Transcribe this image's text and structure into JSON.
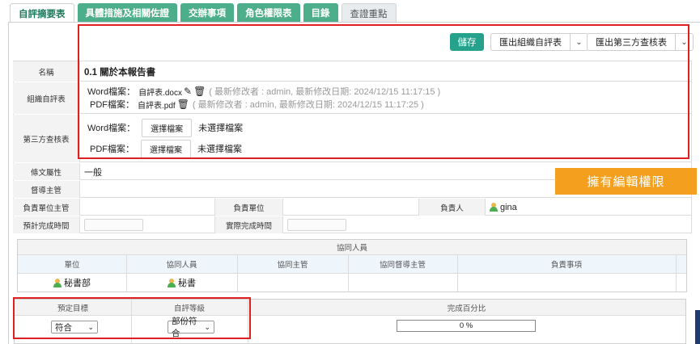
{
  "tabs": [
    "自評摘要表",
    "具體措施及相關佐證",
    "交辦事項",
    "角色權限表",
    "目錄",
    "查證重點"
  ],
  "toolbar": {
    "save_label": "儲存",
    "export_org_label": "匯出組織自評表",
    "export_third_label": "匯出第三方查核表"
  },
  "form": {
    "name_label": "名稱",
    "name_value": "0.1 關於本報告書",
    "org_label": "組織自評表",
    "org_word_label": "Word檔案：",
    "org_word_file": "自評表.docx",
    "org_word_meta": "( 最新修改者 : admin, 最新修改日期: 2024/12/15 11:17:15 )",
    "org_pdf_label": "PDF檔案：",
    "org_pdf_file": "自評表.pdf",
    "org_pdf_meta": "( 最新修改者 : admin, 最新修改日期: 2024/12/15 11:17:25 )",
    "third_label": "第三方查核表",
    "third_word_label": "Word檔案：",
    "third_pdf_label": "PDF檔案：",
    "choose_file": "選擇檔案",
    "no_file": "未選擇檔案",
    "clause_label": "條文屬性",
    "clause_value": "一般",
    "supervisor_label": "督導主管",
    "owner_mgr_label": "負責單位主管",
    "owner_unit_label": "負責單位",
    "owner_person_label": "負責人",
    "owner_person_value": "gina",
    "expected_label": "預計完成時間",
    "actual_label": "實際完成時間"
  },
  "badge": "擁有編輯權限",
  "collab": {
    "title": "協同人員",
    "headers": [
      "單位",
      "協同人員",
      "協同主管",
      "協同督導主管",
      "負責事項"
    ],
    "row": [
      "秘書部",
      "秘書",
      "",
      "",
      ""
    ]
  },
  "bottom": {
    "headers": [
      "預定目標",
      "自評等級",
      "完成百分比"
    ],
    "target_value": "符合",
    "grade_value": "部份符合",
    "percent_label": "0 %",
    "percent": 0
  },
  "colors": {
    "tab_green": "#4cae8a",
    "save_green": "#26a18b",
    "badge_orange": "#f4a01e",
    "highlight_red": "#e02020"
  },
  "icons": [
    "edit-icon",
    "trash-icon",
    "chevron-down-icon",
    "user-icon"
  ]
}
